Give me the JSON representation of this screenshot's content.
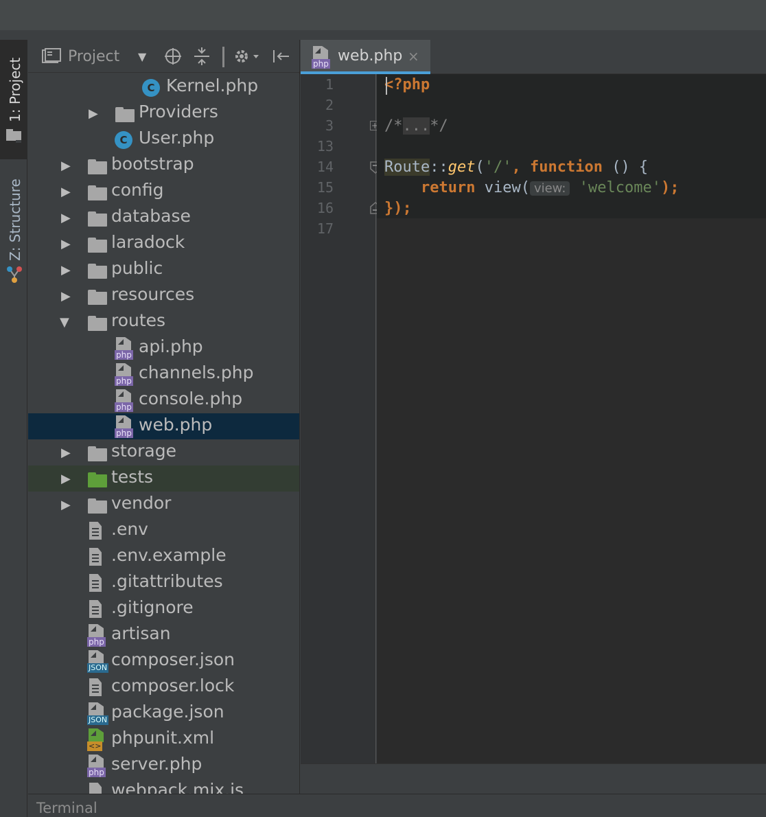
{
  "tool_windows": {
    "project_tab": "1: Project",
    "structure_tab": "Z: Structure"
  },
  "project_panel": {
    "title": "Project",
    "tree": [
      {
        "label": "Kernel.php",
        "icon": "class-c-icon",
        "depth": 4
      },
      {
        "label": "Providers",
        "icon": "folder-icon",
        "depth": 3,
        "expandable": true
      },
      {
        "label": "User.php",
        "icon": "class-c-icon",
        "depth": 3
      },
      {
        "label": "bootstrap",
        "icon": "folder-icon",
        "depth": 2,
        "expandable": true
      },
      {
        "label": "config",
        "icon": "folder-icon",
        "depth": 2,
        "expandable": true
      },
      {
        "label": "database",
        "icon": "folder-icon",
        "depth": 2,
        "expandable": true
      },
      {
        "label": "laradock",
        "icon": "folder-icon",
        "depth": 2,
        "expandable": true
      },
      {
        "label": "public",
        "icon": "folder-icon",
        "depth": 2,
        "expandable": true
      },
      {
        "label": "resources",
        "icon": "folder-icon",
        "depth": 2,
        "expandable": true
      },
      {
        "label": "routes",
        "icon": "folder-icon",
        "depth": 2,
        "expandable": true,
        "expanded": true
      },
      {
        "label": "api.php",
        "icon": "php-file-icon",
        "depth": 3
      },
      {
        "label": "channels.php",
        "icon": "php-file-icon",
        "depth": 3
      },
      {
        "label": "console.php",
        "icon": "php-file-icon",
        "depth": 3
      },
      {
        "label": "web.php",
        "icon": "php-file-icon",
        "depth": 3,
        "selected": true
      },
      {
        "label": "storage",
        "icon": "folder-icon",
        "depth": 2,
        "expandable": true
      },
      {
        "label": "tests",
        "icon": "test-folder-icon",
        "depth": 2,
        "expandable": true
      },
      {
        "label": "vendor",
        "icon": "folder-icon",
        "depth": 2,
        "expandable": true
      },
      {
        "label": ".env",
        "icon": "text-file-icon",
        "depth": 2
      },
      {
        "label": ".env.example",
        "icon": "text-file-icon",
        "depth": 2
      },
      {
        "label": ".gitattributes",
        "icon": "text-file-icon",
        "depth": 2
      },
      {
        "label": ".gitignore",
        "icon": "text-file-icon",
        "depth": 2
      },
      {
        "label": "artisan",
        "icon": "php-file-icon",
        "depth": 2
      },
      {
        "label": "composer.json",
        "icon": "json-file-icon",
        "depth": 2
      },
      {
        "label": "composer.lock",
        "icon": "text-file-icon",
        "depth": 2
      },
      {
        "label": "package.json",
        "icon": "json-file-icon",
        "depth": 2
      },
      {
        "label": "phpunit.xml",
        "icon": "xml-file-icon",
        "depth": 2
      },
      {
        "label": "server.php",
        "icon": "php-file-icon",
        "depth": 2
      },
      {
        "label": "webpack.mix.js",
        "icon": "js-file-icon",
        "depth": 2
      }
    ]
  },
  "file_tags": {
    "php": "php",
    "json": "JSON",
    "xml": "<>"
  },
  "editor": {
    "tab_label": "web.php",
    "close_glyph": "×",
    "line_numbers": [
      "1",
      "2",
      "3",
      "13",
      "14",
      "15",
      "16",
      "17"
    ],
    "code": {
      "line1": "<?php",
      "line3_open": "/*",
      "line3_fold": "...",
      "line3_close": "*/",
      "route": "Route",
      "sep": "::",
      "get": "get",
      "get_args_open": "(",
      "path": "'/'",
      "comma": ", ",
      "function": "function",
      "parens": " () {",
      "indent": "    ",
      "return": "return",
      "view_call": " view(",
      "hint": "view:",
      "welcome": "'welcome'",
      "view_close": ");",
      "close": "});"
    }
  },
  "bottom": {
    "terminal": "Terminal"
  },
  "colors": {
    "background": "#3c3f41",
    "editor_bg": "#2b2b2b",
    "selection": "#0d293e",
    "accent": "#4a9fd8",
    "keyword": "#cc7832",
    "string": "#6a8759",
    "function": "#ffc66d"
  }
}
